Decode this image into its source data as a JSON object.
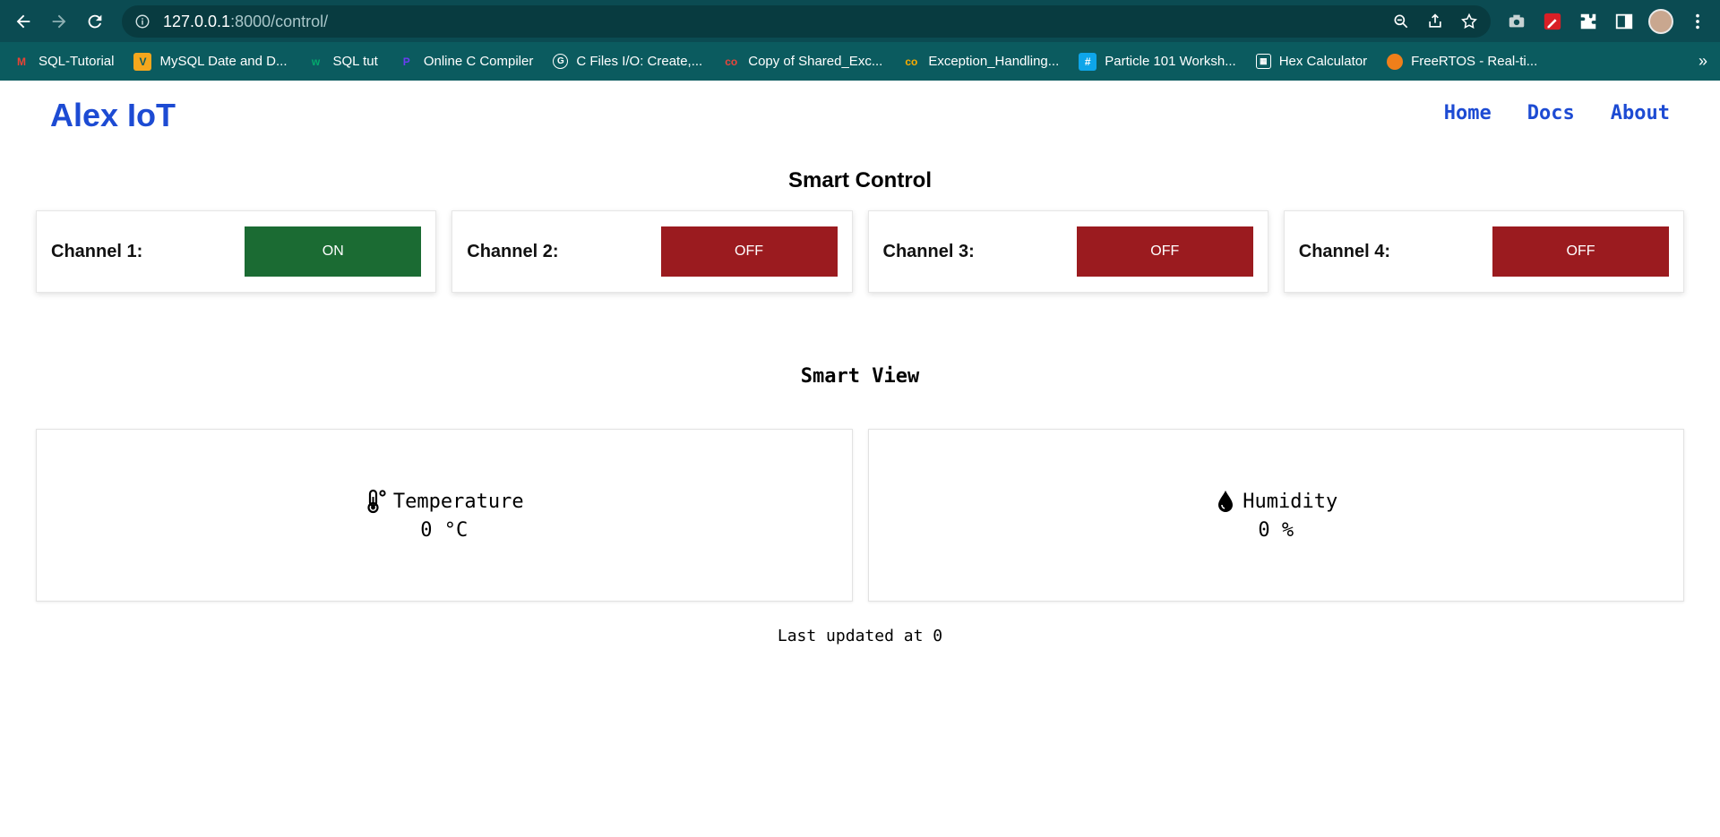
{
  "browser": {
    "url_host": "127.0.0.1",
    "url_path": ":8000/control/",
    "bookmarks": [
      {
        "label": "SQL-Tutorial",
        "icon": "gmail-icon",
        "icon_color": "#ea4335"
      },
      {
        "label": "MySQL Date and D...",
        "icon": "mysql-icon",
        "icon_color": "#f4a71d"
      },
      {
        "label": "SQL tut",
        "icon": "w3-icon",
        "icon_color": "#04aa6d"
      },
      {
        "label": "Online C Compiler",
        "icon": "compiler-icon",
        "icon_color": "#6b3df2"
      },
      {
        "label": "C Files I/O: Create,...",
        "icon": "programiz-icon",
        "icon_color": "#ffffff"
      },
      {
        "label": "Copy of Shared_Exc...",
        "icon": "colab-icon",
        "icon_color": "#e8453c"
      },
      {
        "label": "Exception_Handling...",
        "icon": "colab-icon",
        "icon_color": "#f9ab00"
      },
      {
        "label": "Particle 101 Worksh...",
        "icon": "hash-icon",
        "icon_color": "#0ea5e9"
      },
      {
        "label": "Hex Calculator",
        "icon": "calculator-icon",
        "icon_color": "#ffffff"
      },
      {
        "label": "FreeRTOS - Real-ti...",
        "icon": "freertos-icon",
        "icon_color": "#f07f1a"
      }
    ],
    "more": "»"
  },
  "page": {
    "brand": "Alex IoT",
    "nav": [
      "Home",
      "Docs",
      "About"
    ],
    "control_title": "Smart Control",
    "channels": [
      {
        "label": "Channel 1:",
        "state": "ON"
      },
      {
        "label": "Channel 2:",
        "state": "OFF"
      },
      {
        "label": "Channel 3:",
        "state": "OFF"
      },
      {
        "label": "Channel 4:",
        "state": "OFF"
      }
    ],
    "view_title": "Smart View",
    "sensors": [
      {
        "label": "Temperature",
        "value": "0 °C",
        "icon": "thermometer-icon"
      },
      {
        "label": "Humidity",
        "value": "0 %",
        "icon": "droplet-icon"
      }
    ],
    "last_updated": "Last updated at 0"
  },
  "colors": {
    "brand": "#1d4bd3",
    "on": "#1b6b33",
    "off": "#9b1b1f",
    "toolbar": "#0b4b52",
    "bookmarks_bar": "#0b5b5f"
  }
}
